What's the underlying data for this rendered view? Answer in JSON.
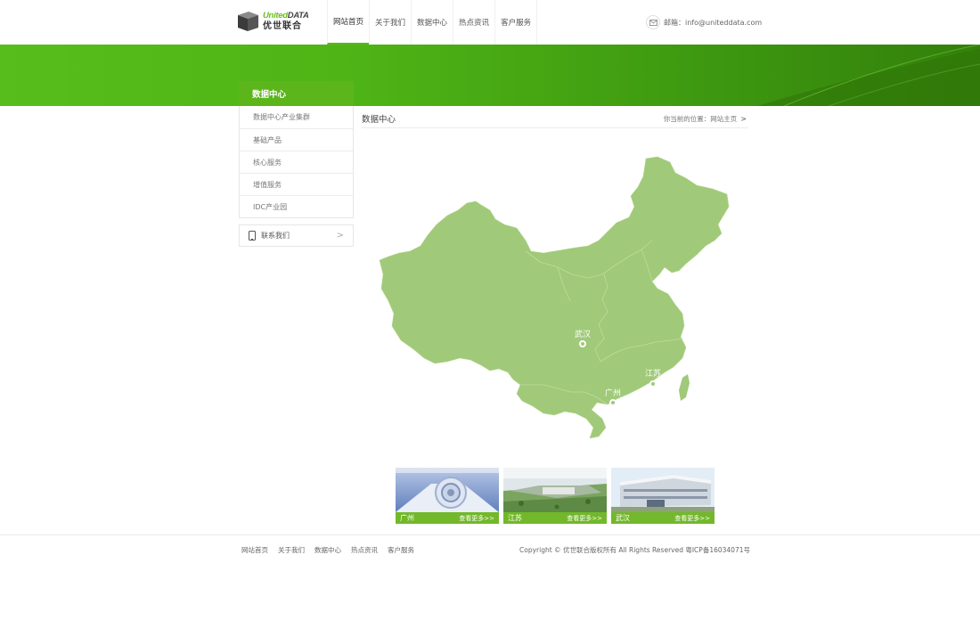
{
  "brand": {
    "logo_en_1": "United",
    "logo_en_2": "DATA",
    "logo_cn": "优世联合"
  },
  "nav": {
    "items": [
      {
        "label": "网站首页",
        "active": true
      },
      {
        "label": "关于我们"
      },
      {
        "label": "数据中心"
      },
      {
        "label": "热点资讯"
      },
      {
        "label": "客户服务"
      }
    ]
  },
  "contact_mail": {
    "label": "邮箱：info@uniteddata.com"
  },
  "sidebar": {
    "title": "数据中心",
    "items": [
      {
        "label": "数据中心产业集群"
      },
      {
        "label": "基础产品"
      },
      {
        "label": "核心服务"
      },
      {
        "label": "增值服务"
      },
      {
        "label": "IDC产业园"
      }
    ],
    "contact": {
      "label": "联系我们",
      "chevron": ">"
    }
  },
  "main": {
    "title": "数据中心",
    "breadcrumb": "你当前的位置：网站主页",
    "breadcrumb_arrow": ">",
    "map_markers": [
      {
        "label": "武汉"
      },
      {
        "label": "江苏"
      },
      {
        "label": "广州"
      }
    ]
  },
  "thumbnails": [
    {
      "city": "广州",
      "more": "查看更多>>"
    },
    {
      "city": "江苏",
      "more": "查看更多>>"
    },
    {
      "city": "武汉",
      "more": "查看更多>>"
    }
  ],
  "footer": {
    "links": [
      {
        "label": "网站首页"
      },
      {
        "label": "关于我们"
      },
      {
        "label": "数据中心"
      },
      {
        "label": "热点资讯"
      },
      {
        "label": "客户服务"
      }
    ],
    "copyright": "Copyright © 优世联合版权所有 All Rights Reserved  粤ICP备16034071号"
  },
  "colors": {
    "accent": "#5cb51b",
    "map_fill": "#a0c979",
    "thumb_bar": "#72b82a"
  }
}
